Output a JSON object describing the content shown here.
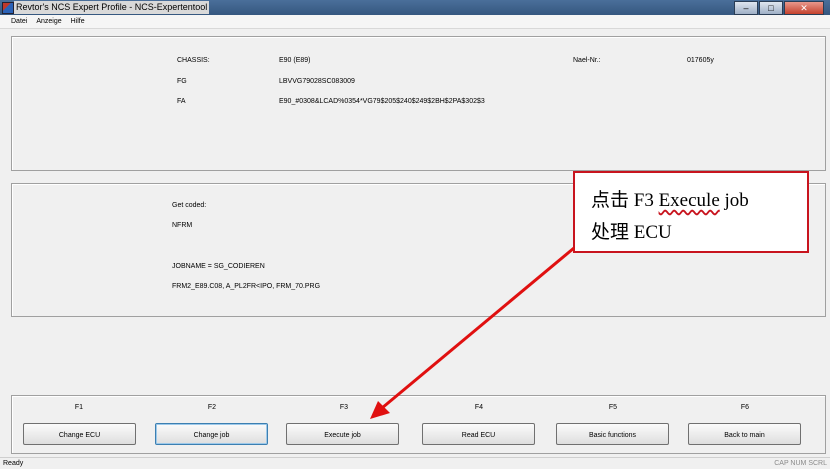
{
  "window": {
    "title": "Revtor's NCS Expert Profile - NCS-Expertentool",
    "min": "–",
    "max": "□",
    "close": "✕"
  },
  "menu": [
    "Datei",
    "Anzeige",
    "Hilfe"
  ],
  "vehicle_panel": {
    "chassis_label": "CHASSIS:",
    "chassis_value": "E90 (E89)",
    "fg_label": "FG",
    "fg_value": "LBVVG79028SC083009",
    "fa_label": "FA",
    "fa_value": "E90_#0308&LCAD%0354*VG79$205$240$249$2BH$2PA$302$3",
    "nael_label": "Nael-Nr.:",
    "nael_value": "017605y"
  },
  "job_panel": {
    "line1": "Get coded:",
    "line2": "NFRM",
    "line3": "JOBNAME = SG_CODIEREN",
    "line4": "FRM2_E89.C08, A_PL2FR<IPO, FRM_70.PRG"
  },
  "function_keys": [
    {
      "key": "F1",
      "label": "Change ECU"
    },
    {
      "key": "F2",
      "label": "Change job"
    },
    {
      "key": "F3",
      "label": "Execute job"
    },
    {
      "key": "F4",
      "label": "Read ECU"
    },
    {
      "key": "F5",
      "label": "Basic functions"
    },
    {
      "key": "F6",
      "label": "Back to main"
    }
  ],
  "annotation": {
    "line1_pre": "点击 F3 ",
    "line1_word": "Execule",
    "line1_post": " job",
    "line2": "处理 ECU",
    "color": "#c8141e"
  },
  "status": {
    "left": "Ready",
    "right": "CAP  NUM  SCRL"
  }
}
